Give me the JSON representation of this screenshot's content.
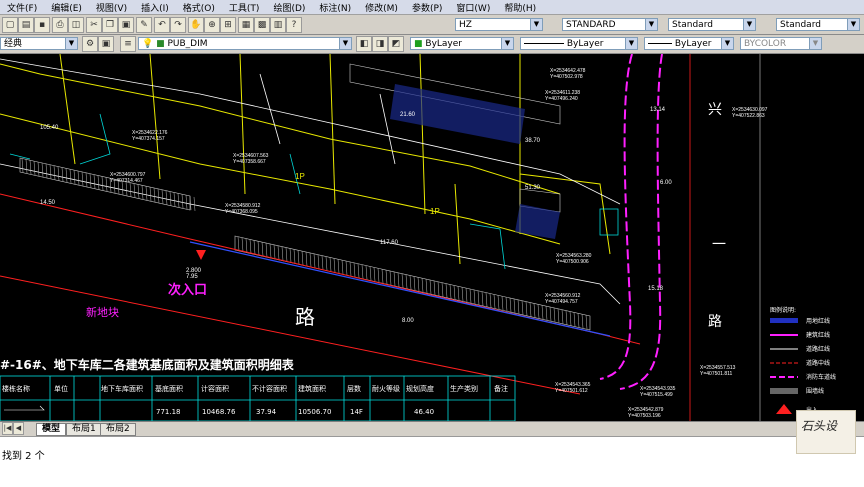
{
  "menu": [
    "文件(F)",
    "编辑(E)",
    "视图(V)",
    "插入(I)",
    "格式(O)",
    "工具(T)",
    "绘图(D)",
    "标注(N)",
    "修改(M)",
    "参数(P)",
    "窗口(W)",
    "帮助(H)"
  ],
  "toolbar1": {
    "textstyle": "HZ",
    "dimstyle": "STANDARD",
    "tablestyle": "Standard",
    "mleaderstyle": "Standard"
  },
  "toolbar2": {
    "workspace": "经典",
    "layer": "PUB_DIM",
    "color": "ByLayer",
    "linetype": "ByLayer",
    "lineweight": "ByLayer",
    "plotstyle": "BYCOLOR"
  },
  "drawing": {
    "labels": {
      "road_right_top": "兴",
      "road_right_mid": "一",
      "road_right_bottom": "路",
      "road_bottom": "路",
      "entrance": "次入口",
      "block": "新地块",
      "table_title": "#-16#、地下车库二各建筑基底面积及建筑面积明细表",
      "plot_1p": "1P",
      "plot_1p_b": "1P"
    },
    "coords": [
      "X=2534642.478",
      "Y=407502.978",
      "X=2534611.238",
      "Y=407496.240",
      "X=2534630.097",
      "Y=407522.863",
      "X=2534622.176",
      "Y=407374.157",
      "X=2534600.797",
      "Y=407314.467",
      "X=2534607.563",
      "Y=407358.667",
      "X=2534580.912",
      "Y=407368.095",
      "X=2534563.280",
      "Y=407500.906",
      "X=2534560.912",
      "Y=407494.757",
      "X=2534557.513",
      "Y=407501.811",
      "X=2534543.935",
      "Y=407515.499",
      "X=2534543.365",
      "Y=407501.612",
      "X=2534542.879",
      "Y=407503.196"
    ],
    "dims": [
      "21.60",
      "38.70",
      "51.30",
      "117.60",
      "105.40",
      "14.50",
      "13.14",
      "15.18",
      "6.00",
      "2.800",
      "7.95",
      "8.00"
    ],
    "legend_title": "图例说明:",
    "legend_items": [
      "用地红线",
      "建筑红线",
      "道路红线",
      "道路中线",
      "消防车道线",
      "围墙线",
      "出入"
    ],
    "table": {
      "headers": [
        "楼栋名称",
        "单位",
        "地下车库面积",
        "基底面积",
        "计容面积",
        "不计容面积",
        "建筑面积",
        "层数",
        "耐火等级",
        "规划高度",
        "生产类别",
        "备注"
      ],
      "row1": [
        "",
        "",
        "",
        "771.18",
        "10468.76",
        "37.94",
        "10506.70",
        "14F",
        "",
        "46.40",
        "",
        ""
      ]
    }
  },
  "tabs": [
    "模型",
    "布局1",
    "布局2"
  ],
  "command": {
    "line1": "找到 2 个"
  },
  "watermark": "石头设"
}
